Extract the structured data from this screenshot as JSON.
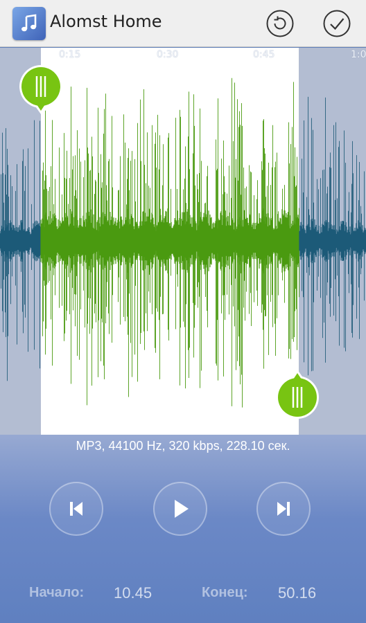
{
  "app": {
    "title": "Alomst Home",
    "icon": "music-note-icon",
    "actions": [
      {
        "name": "reset",
        "icon": "refresh-icon"
      },
      {
        "name": "save",
        "icon": "check-icon"
      }
    ]
  },
  "waveform": {
    "time_ticks": [
      "0:15",
      "0:30",
      "0:45",
      "1:0"
    ],
    "colors": {
      "background": "#b3bdd2",
      "selection_background": "#ffffff",
      "wave_unselected": "#1d5a78",
      "wave_selected": "#4a9a10",
      "handle": "#78c412"
    }
  },
  "file_info": "MP3, 44100 Hz, 320 kbps, 228.10 сек.",
  "player": {
    "controls": [
      {
        "name": "previous",
        "icon": "skip-previous-icon"
      },
      {
        "name": "play",
        "icon": "play-icon"
      },
      {
        "name": "next",
        "icon": "skip-next-icon"
      }
    ]
  },
  "range": {
    "start_label": "Начало:",
    "start_value": "10.45",
    "end_label": "Конец:",
    "end_value": "50.16"
  }
}
